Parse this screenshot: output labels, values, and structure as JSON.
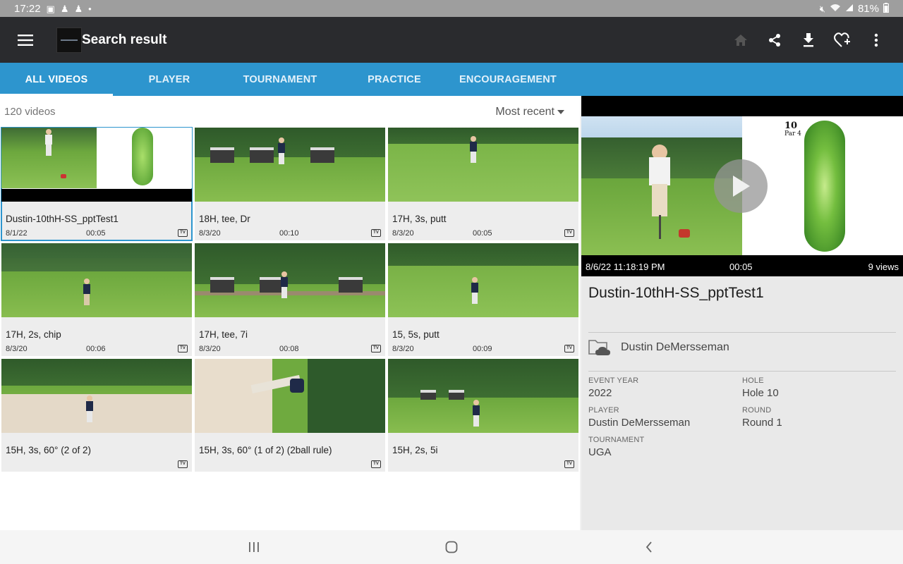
{
  "status_bar": {
    "time": "17:22",
    "battery": "81%"
  },
  "app_bar": {
    "title": "Search result",
    "icons": [
      "menu-icon",
      "home-icon",
      "share-icon",
      "download-icon",
      "favorite-add-icon",
      "more-vert-icon"
    ]
  },
  "tabs": [
    {
      "label": "ALL VIDEOS",
      "active": true
    },
    {
      "label": "PLAYER",
      "active": false
    },
    {
      "label": "TOURNAMENT",
      "active": false
    },
    {
      "label": "PRACTICE",
      "active": false
    },
    {
      "label": "ENCOURAGEMENT",
      "active": false
    }
  ],
  "list": {
    "count_label": "120 videos",
    "sort_label": "Most recent",
    "videos": [
      {
        "name": "Dustin-10thH-SS_pptTest1",
        "date": "8/1/22",
        "duration": "00:05",
        "badge": "TV",
        "selected": true
      },
      {
        "name": "18H, tee, Dr",
        "date": "8/3/20",
        "duration": "00:10",
        "badge": "TV"
      },
      {
        "name": "17H, 3s, putt",
        "date": "8/3/20",
        "duration": "00:05",
        "badge": "TV"
      },
      {
        "name": "17H, 2s, chip",
        "date": "8/3/20",
        "duration": "00:06",
        "badge": "TV"
      },
      {
        "name": "17H, tee, 7i",
        "date": "8/3/20",
        "duration": "00:08",
        "badge": "TV"
      },
      {
        "name": "15, 5s, putt",
        "date": "8/3/20",
        "duration": "00:09",
        "badge": "TV"
      },
      {
        "name": "15H, 3s, 60° (2 of 2)",
        "date": "",
        "duration": "",
        "badge": "TV"
      },
      {
        "name": "15H, 3s, 60° (1 of 2) (2ball rule)",
        "date": "",
        "duration": "",
        "badge": "TV"
      },
      {
        "name": "15H, 2s, 5i",
        "date": "",
        "duration": "",
        "badge": "TV"
      }
    ]
  },
  "detail": {
    "player_date": "8/6/22 11:18:19 PM",
    "player_duration": "00:05",
    "player_views": "9 views",
    "map_hole_number": "10",
    "map_par": "Par 4",
    "title": "Dustin-10thH-SS_pptTest1",
    "owner": "Dustin DeMersseman",
    "fields": {
      "event_year_label": "EVENT YEAR",
      "event_year": "2022",
      "hole_label": "HOLE",
      "hole": "Hole 10",
      "player_label": "PLAYER",
      "player": "Dustin DeMersseman",
      "round_label": "ROUND",
      "round": "Round 1",
      "tournament_label": "TOURNAMENT",
      "tournament": "UGA"
    }
  },
  "colors": {
    "app_bar": "#2a2b2e",
    "tab_bar": "#2d95ce",
    "accent": "#2d95ce",
    "status_bar": "#9e9e9e"
  }
}
